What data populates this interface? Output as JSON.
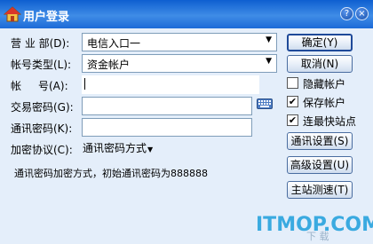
{
  "window": {
    "title": "用户登录",
    "help_label": "?",
    "close_label": "×"
  },
  "form": {
    "department_label": "营 业 部(D):",
    "department_value": "电信入口一",
    "account_type_label": "帐号类型(L):",
    "account_type_value": "资金帐户",
    "account_label_1": "帐",
    "account_label_2": "号(A):",
    "account_value": "",
    "trade_password_label": "交易密码(G):",
    "comm_password_label": "通讯密码(K):",
    "encryption_label": "加密协议(C):",
    "encryption_value": "通讯密码方式",
    "info_text": "通讯密码加密方式，初始通讯密码为888888"
  },
  "buttons": {
    "confirm": "确定(Y)",
    "cancel": "取消(N)",
    "comm_settings": "通讯设置(S)",
    "advanced_settings": "高级设置(U)",
    "server_speed": "主站测速(T)"
  },
  "checkboxes": {
    "hide_account": {
      "label": "隐藏帐户",
      "checked": false
    },
    "save_account": {
      "label": "保存帐户",
      "checked": true
    },
    "fastest_server": {
      "label": "连最快站点",
      "checked": true
    }
  },
  "watermark": {
    "text": "ITMOP.COM",
    "sub": "下 载"
  },
  "colors": {
    "title_bar": "#1c6ad8",
    "window_bg": "#e4eefa",
    "button_border": "#4a6da0",
    "watermark": "#3aaae0"
  }
}
